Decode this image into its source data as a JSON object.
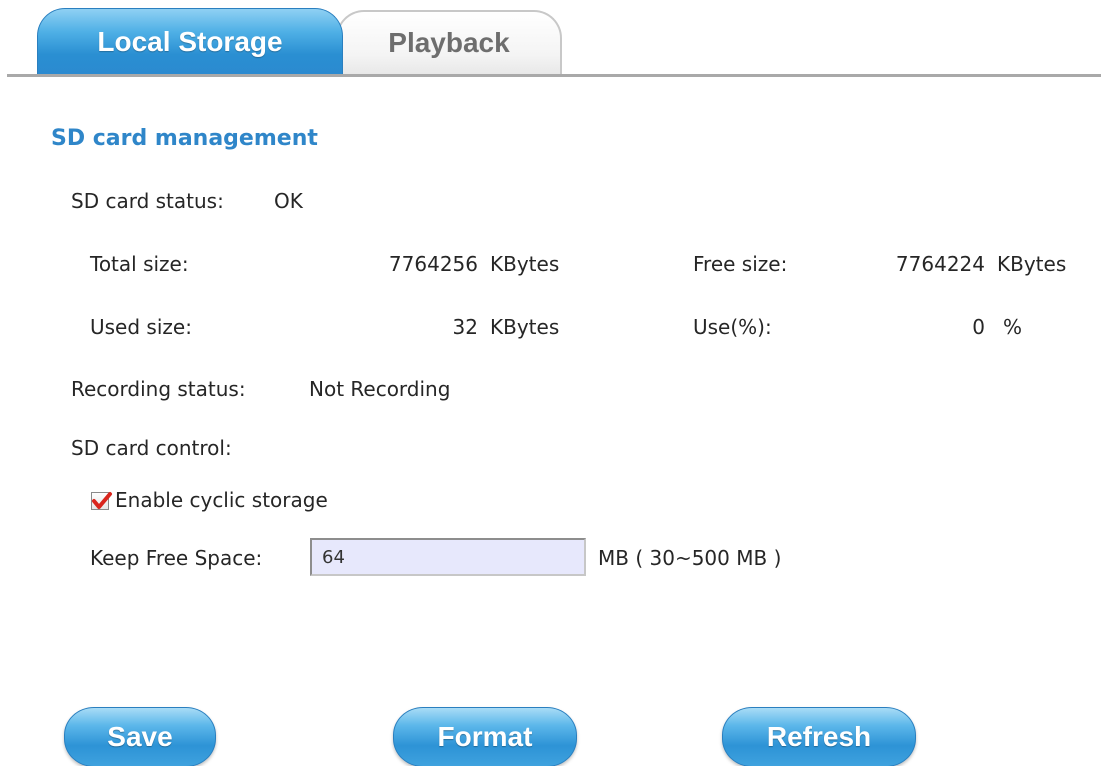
{
  "tabs": {
    "local_storage": "Local Storage",
    "playback": "Playback"
  },
  "section_title": "SD card management",
  "sd_status": {
    "label": "SD card status:",
    "value": "OK"
  },
  "sizes": {
    "total_label": "Total size:",
    "total_value": "7764256",
    "total_unit": "KBytes",
    "free_label": "Free size:",
    "free_value": "7764224",
    "free_unit": "KBytes",
    "used_label": "Used size:",
    "used_value": "32",
    "used_unit": "KBytes",
    "use_pct_label": "Use(%):",
    "use_pct_value": "0",
    "use_pct_unit": "%"
  },
  "recording": {
    "label": "Recording status:",
    "value": "Not Recording"
  },
  "control": {
    "label": "SD card control:",
    "cyclic_label": "Enable cyclic storage",
    "cyclic_checked": true,
    "keep_free_label": "Keep Free Space:",
    "keep_free_value": "64",
    "keep_free_hint": "MB ( 30~500 MB )"
  },
  "buttons": {
    "save": "Save",
    "format": "Format",
    "refresh": "Refresh"
  },
  "colors": {
    "accent": "#2f86c9",
    "checkmark": "#d9251d",
    "input_bg": "#e7e8fc"
  }
}
